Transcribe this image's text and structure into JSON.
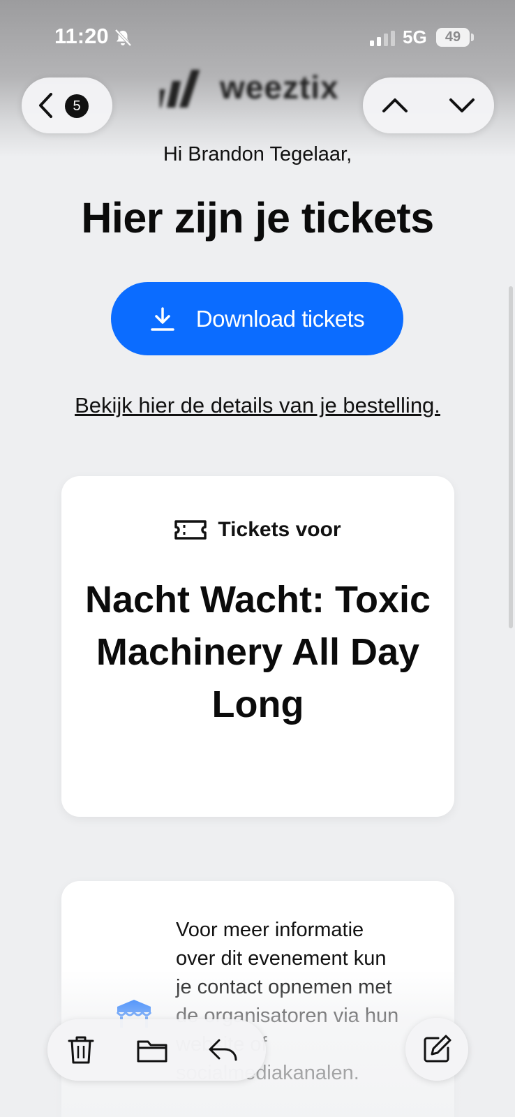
{
  "status_bar": {
    "time": "11:20",
    "network": "5G",
    "battery": "49"
  },
  "header": {
    "brand": "weeztix",
    "unread_count": "5"
  },
  "email": {
    "greeting": "Hi Brandon Tegelaar,",
    "headline": "Hier zijn je tickets",
    "download_label": "Download tickets",
    "details_link": "Bekijk hier de details van je bestelling.",
    "ticket_card": {
      "label": "Tickets voor",
      "event_title": "Nacht Wacht: Toxic Machinery All Day Long"
    },
    "info_card": {
      "text": "Voor meer informatie over dit evenement kun je contact opnemen met de organisatoren via hun website of socialmediakanalen."
    }
  },
  "colors": {
    "accent": "#0b6cff",
    "page_background": "#eeeff1",
    "card_background": "#ffffff"
  },
  "icons": {
    "muted": "bell-slash-icon",
    "back": "chevron-left-icon",
    "previous": "chevron-up-icon",
    "next": "chevron-down-icon",
    "download": "download-icon",
    "ticket": "ticket-icon",
    "venue": "venue-icon",
    "delete": "trash-icon",
    "move": "folder-icon",
    "reply": "reply-icon",
    "compose": "compose-icon"
  }
}
